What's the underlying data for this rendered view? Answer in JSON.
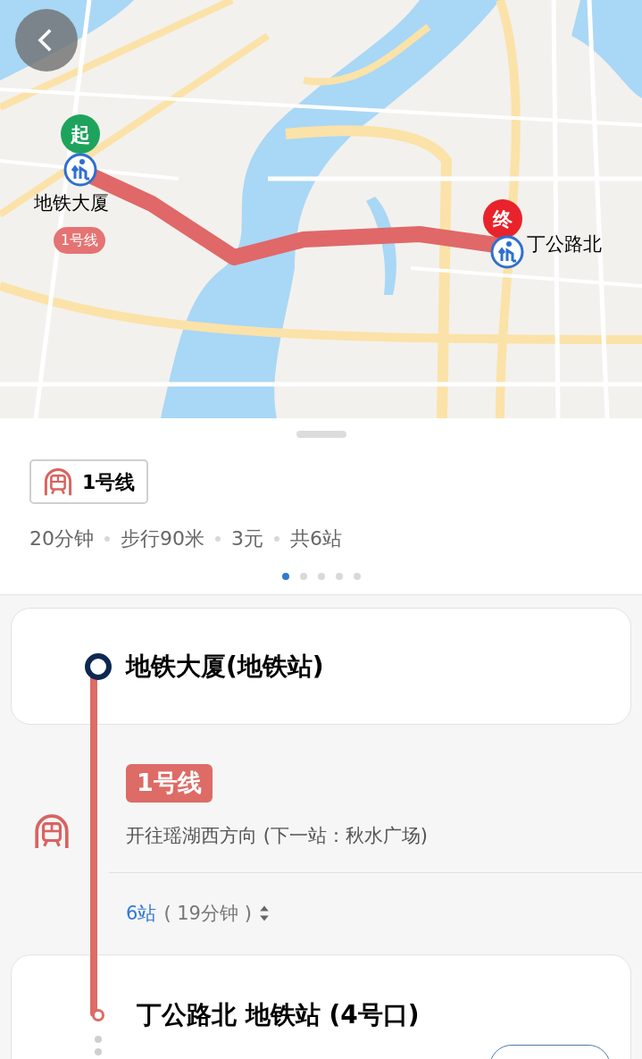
{
  "map": {
    "start": {
      "badge": "起",
      "label": "地铁大厦",
      "line": "1号线"
    },
    "end": {
      "badge": "终",
      "label": "丁公路北"
    }
  },
  "summary": {
    "line": "1号线",
    "stats": [
      "20分钟",
      "步行90米",
      "3元",
      "共6站"
    ],
    "pages": [
      {
        "selected": true
      },
      {
        "selected": false
      },
      {
        "selected": false
      },
      {
        "selected": false
      },
      {
        "selected": false
      }
    ]
  },
  "start_station": {
    "name": "地铁大厦(地铁站)"
  },
  "ride": {
    "line": "1号线",
    "direction": "开往瑶湖西方向 (下一站：秋水广场)",
    "stops": "6站",
    "duration": "( 19分钟 )"
  },
  "end_station": {
    "name": "丁公路北 地铁站 (4号口)"
  }
}
